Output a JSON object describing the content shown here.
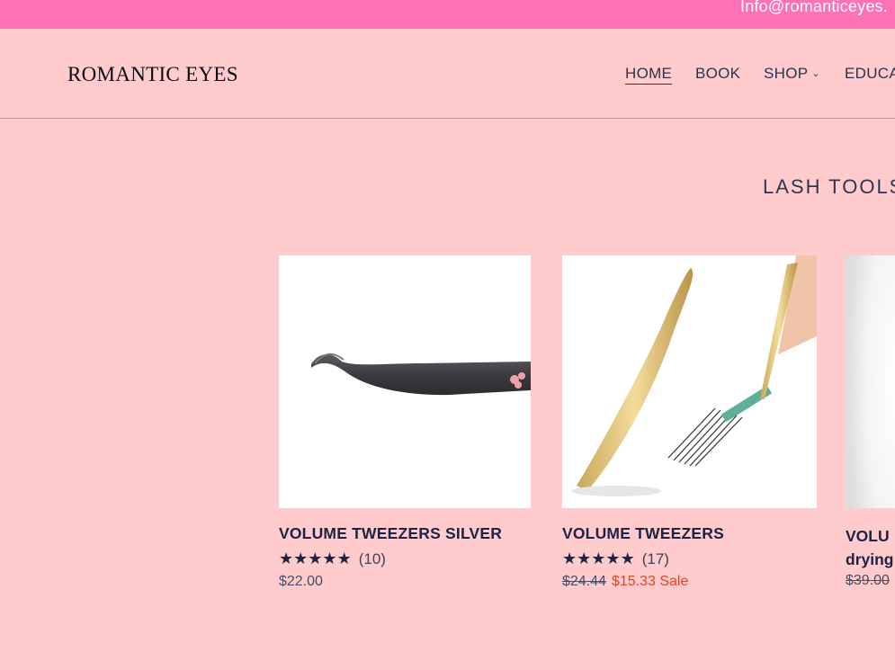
{
  "topbar": {
    "email": "Info@romanticeyes."
  },
  "header": {
    "logo": "ROMANTIC EYES",
    "nav": [
      {
        "label": "HOME"
      },
      {
        "label": "BOOK"
      },
      {
        "label": "SHOP"
      },
      {
        "label": "EDUCA"
      }
    ]
  },
  "section": {
    "title": "LASH TOOLS"
  },
  "products": [
    {
      "title": "VOLUME TWEEZERS SILVER",
      "rating_count": "(10)",
      "price": "$22.00"
    },
    {
      "title": "VOLUME TWEEZERS",
      "rating_count": "(17)",
      "old_price": "$24.44",
      "sale_price": "$15.33",
      "sale_label": "Sale"
    },
    {
      "title_line1": "VOLU",
      "title_line2": "drying",
      "old_price": "$39.00"
    }
  ],
  "colors": {
    "background": "#ffcbcc",
    "topbar": "#ff71b6",
    "navy": "#1c2344",
    "sale": "#d9472c"
  },
  "icons": {
    "star": "star-icon",
    "caret": "chevron-down-icon"
  }
}
